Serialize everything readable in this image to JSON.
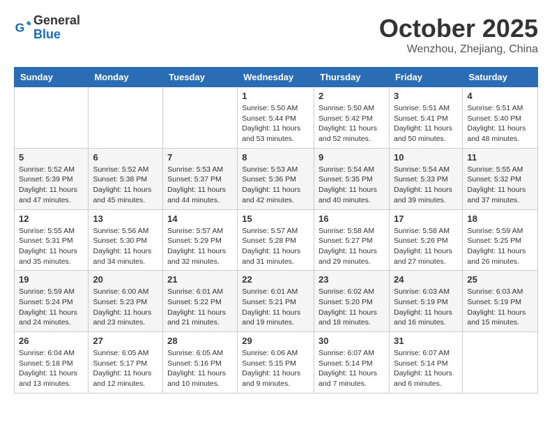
{
  "header": {
    "logo_general": "General",
    "logo_blue": "Blue",
    "month": "October 2025",
    "location": "Wenzhou, Zhejiang, China"
  },
  "days_of_week": [
    "Sunday",
    "Monday",
    "Tuesday",
    "Wednesday",
    "Thursday",
    "Friday",
    "Saturday"
  ],
  "weeks": [
    [
      {
        "day": "",
        "info": ""
      },
      {
        "day": "",
        "info": ""
      },
      {
        "day": "",
        "info": ""
      },
      {
        "day": "1",
        "info": "Sunrise: 5:50 AM\nSunset: 5:44 PM\nDaylight: 11 hours\nand 53 minutes."
      },
      {
        "day": "2",
        "info": "Sunrise: 5:50 AM\nSunset: 5:42 PM\nDaylight: 11 hours\nand 52 minutes."
      },
      {
        "day": "3",
        "info": "Sunrise: 5:51 AM\nSunset: 5:41 PM\nDaylight: 11 hours\nand 50 minutes."
      },
      {
        "day": "4",
        "info": "Sunrise: 5:51 AM\nSunset: 5:40 PM\nDaylight: 11 hours\nand 48 minutes."
      }
    ],
    [
      {
        "day": "5",
        "info": "Sunrise: 5:52 AM\nSunset: 5:39 PM\nDaylight: 11 hours\nand 47 minutes."
      },
      {
        "day": "6",
        "info": "Sunrise: 5:52 AM\nSunset: 5:38 PM\nDaylight: 11 hours\nand 45 minutes."
      },
      {
        "day": "7",
        "info": "Sunrise: 5:53 AM\nSunset: 5:37 PM\nDaylight: 11 hours\nand 44 minutes."
      },
      {
        "day": "8",
        "info": "Sunrise: 5:53 AM\nSunset: 5:36 PM\nDaylight: 11 hours\nand 42 minutes."
      },
      {
        "day": "9",
        "info": "Sunrise: 5:54 AM\nSunset: 5:35 PM\nDaylight: 11 hours\nand 40 minutes."
      },
      {
        "day": "10",
        "info": "Sunrise: 5:54 AM\nSunset: 5:33 PM\nDaylight: 11 hours\nand 39 minutes."
      },
      {
        "day": "11",
        "info": "Sunrise: 5:55 AM\nSunset: 5:32 PM\nDaylight: 11 hours\nand 37 minutes."
      }
    ],
    [
      {
        "day": "12",
        "info": "Sunrise: 5:55 AM\nSunset: 5:31 PM\nDaylight: 11 hours\nand 35 minutes."
      },
      {
        "day": "13",
        "info": "Sunrise: 5:56 AM\nSunset: 5:30 PM\nDaylight: 11 hours\nand 34 minutes."
      },
      {
        "day": "14",
        "info": "Sunrise: 5:57 AM\nSunset: 5:29 PM\nDaylight: 11 hours\nand 32 minutes."
      },
      {
        "day": "15",
        "info": "Sunrise: 5:57 AM\nSunset: 5:28 PM\nDaylight: 11 hours\nand 31 minutes."
      },
      {
        "day": "16",
        "info": "Sunrise: 5:58 AM\nSunset: 5:27 PM\nDaylight: 11 hours\nand 29 minutes."
      },
      {
        "day": "17",
        "info": "Sunrise: 5:58 AM\nSunset: 5:26 PM\nDaylight: 11 hours\nand 27 minutes."
      },
      {
        "day": "18",
        "info": "Sunrise: 5:59 AM\nSunset: 5:25 PM\nDaylight: 11 hours\nand 26 minutes."
      }
    ],
    [
      {
        "day": "19",
        "info": "Sunrise: 5:59 AM\nSunset: 5:24 PM\nDaylight: 11 hours\nand 24 minutes."
      },
      {
        "day": "20",
        "info": "Sunrise: 6:00 AM\nSunset: 5:23 PM\nDaylight: 11 hours\nand 23 minutes."
      },
      {
        "day": "21",
        "info": "Sunrise: 6:01 AM\nSunset: 5:22 PM\nDaylight: 11 hours\nand 21 minutes."
      },
      {
        "day": "22",
        "info": "Sunrise: 6:01 AM\nSunset: 5:21 PM\nDaylight: 11 hours\nand 19 minutes."
      },
      {
        "day": "23",
        "info": "Sunrise: 6:02 AM\nSunset: 5:20 PM\nDaylight: 11 hours\nand 18 minutes."
      },
      {
        "day": "24",
        "info": "Sunrise: 6:03 AM\nSunset: 5:19 PM\nDaylight: 11 hours\nand 16 minutes."
      },
      {
        "day": "25",
        "info": "Sunrise: 6:03 AM\nSunset: 5:19 PM\nDaylight: 11 hours\nand 15 minutes."
      }
    ],
    [
      {
        "day": "26",
        "info": "Sunrise: 6:04 AM\nSunset: 5:18 PM\nDaylight: 11 hours\nand 13 minutes."
      },
      {
        "day": "27",
        "info": "Sunrise: 6:05 AM\nSunset: 5:17 PM\nDaylight: 11 hours\nand 12 minutes."
      },
      {
        "day": "28",
        "info": "Sunrise: 6:05 AM\nSunset: 5:16 PM\nDaylight: 11 hours\nand 10 minutes."
      },
      {
        "day": "29",
        "info": "Sunrise: 6:06 AM\nSunset: 5:15 PM\nDaylight: 11 hours\nand 9 minutes."
      },
      {
        "day": "30",
        "info": "Sunrise: 6:07 AM\nSunset: 5:14 PM\nDaylight: 11 hours\nand 7 minutes."
      },
      {
        "day": "31",
        "info": "Sunrise: 6:07 AM\nSunset: 5:14 PM\nDaylight: 11 hours\nand 6 minutes."
      },
      {
        "day": "",
        "info": ""
      }
    ]
  ]
}
